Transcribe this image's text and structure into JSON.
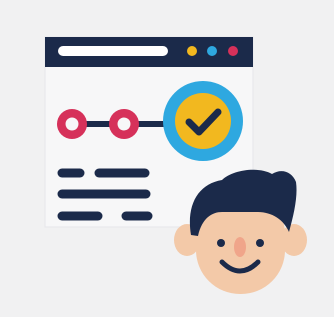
{
  "illustration": {
    "subject": "browser-window-with-progress-steps-and-user-avatar",
    "icons": [
      "browser-window-icon",
      "address-bar-icon",
      "window-control-dots",
      "progress-step-icon",
      "checkmark-badge-icon",
      "text-lines-icon",
      "user-avatar-icon"
    ],
    "progress": {
      "steps_total": 3,
      "steps_completed": 3,
      "current_step_state": "checked"
    },
    "colors": {
      "background": "#f1f1f2",
      "window_body": "#f7f7f8",
      "window_bar": "#1b2a4a",
      "navy": "#1b2a4a",
      "dot_yellow": "#f2b81f",
      "dot_blue": "#2ea8e0",
      "dot_red": "#d6315a",
      "step_red": "#d6315a",
      "check_ring": "#2ea8e0",
      "check_fill": "#f2b81f",
      "skin": "#f3c9a8",
      "cheek": "#f0a58a",
      "hair": "#1b2a4a"
    }
  }
}
